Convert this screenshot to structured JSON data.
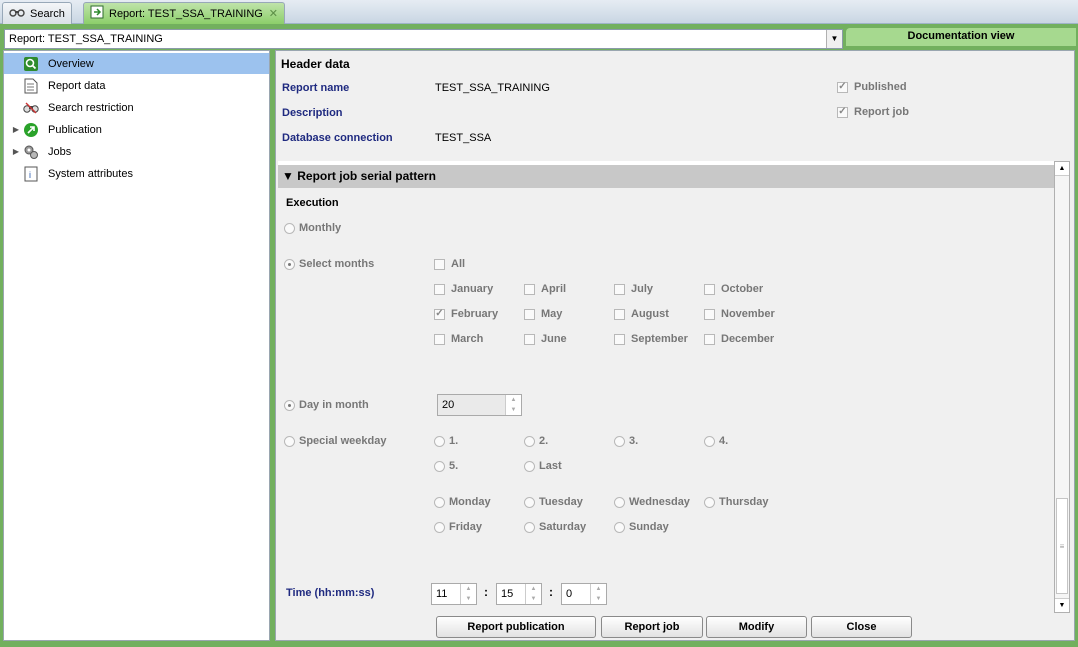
{
  "tabs": [
    {
      "label": "Search",
      "icon": "binoculars-icon"
    },
    {
      "label": "Report: TEST_SSA_TRAINING",
      "icon": "report-icon",
      "close": "✕"
    }
  ],
  "report_select": {
    "value": "Report: TEST_SSA_TRAINING"
  },
  "doc_view_label": "Documentation view",
  "nav": {
    "items": [
      {
        "label": "Overview",
        "icon": "overview-icon"
      },
      {
        "label": "Report data",
        "icon": "document-icon"
      },
      {
        "label": "Search restriction",
        "icon": "binoculars-icon"
      },
      {
        "label": "Publication",
        "icon": "publication-icon"
      },
      {
        "label": "Jobs",
        "icon": "jobs-icon"
      },
      {
        "label": "System attributes",
        "icon": "attributes-icon"
      }
    ]
  },
  "header": {
    "title": "Header data",
    "report_name_label": "Report name",
    "report_name_value": "TEST_SSA_TRAINING",
    "description_label": "Description",
    "db_label": "Database connection",
    "db_value": "TEST_SSA",
    "published_label": "Published",
    "report_job_label": "Report job"
  },
  "pattern": {
    "title": "Report job serial pattern",
    "execution_label": "Execution",
    "monthly": "Monthly",
    "select_months": "Select months",
    "all": "All",
    "months": [
      "January",
      "April",
      "July",
      "October",
      "February",
      "May",
      "August",
      "November",
      "March",
      "June",
      "September",
      "December"
    ],
    "day_in_month": "Day in month",
    "day_value": "20",
    "special_weekday": "Special weekday",
    "ordinals": [
      "1.",
      "2.",
      "3.",
      "4.",
      "5.",
      "Last"
    ],
    "weekdays": [
      "Monday",
      "Tuesday",
      "Wednesday",
      "Thursday",
      "Friday",
      "Saturday",
      "Sunday"
    ],
    "time_label": "Time (hh:mm:ss)",
    "hh": "11",
    "mm": "15",
    "ss": "0"
  },
  "buttons": {
    "publication": "Report publication",
    "job": "Report job",
    "modify": "Modify",
    "close": "Close"
  },
  "colors": {
    "green": "#72b05e",
    "nav_active": "#9cc2ee",
    "label_blue": "#1f2a80"
  }
}
